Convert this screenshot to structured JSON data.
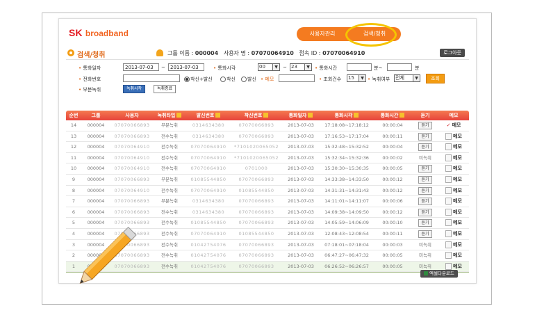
{
  "brand": {
    "sk": "SK",
    "broadband": "broadband"
  },
  "topnav": {
    "user_mgmt": "사용자관리",
    "search": "검색/청취"
  },
  "page_title": "검색/청취",
  "user_info": {
    "group_label": "그룹 이름 :",
    "group_value": "000004",
    "user_label": "사용자 명 :",
    "user_value": "07070064910",
    "login_label": "접속 ID :",
    "login_value": "07070064910"
  },
  "logout_label": "로그아웃",
  "search": {
    "date_label": "통화일자",
    "date_from": "2013-07-03",
    "date_tilde": "~",
    "date_to": "2013-07-03",
    "time_label": "통화시각",
    "time_from": "00",
    "time_tilde": "~",
    "time_to": "23",
    "duration_label": "통화시간",
    "duration_from": "",
    "duration_from_unit": "분~",
    "duration_to": "",
    "duration_to_unit": "분",
    "phone_label": "전화번호",
    "phone_value": "",
    "radio_both": "착신+발신",
    "radio_in": "착신",
    "radio_out": "발신",
    "memo_label": "메모",
    "memo_value": "",
    "count_label": "조회건수",
    "count_value": "15",
    "recyn_label": "녹취여부",
    "recyn_value": "전체",
    "search_button": "조회",
    "partial_label": "부분녹취",
    "rec_start": "녹취시작",
    "rec_end": "녹취종료"
  },
  "grid": {
    "headers": [
      "순번",
      "그룹",
      "사용자",
      "녹취타입",
      "발신번호",
      "착신번호",
      "통화일자",
      "통화시각",
      "통화시간",
      "듣기",
      "메모"
    ],
    "listen_label": "듣기",
    "none_label": "미녹취",
    "memo_label": "메모",
    "rows": [
      {
        "no": "14",
        "group": "000004",
        "user": "07070066893",
        "type": "부분녹취",
        "from": "0314634380",
        "to": "07070066893",
        "date": "2013-07-03",
        "time": "17:18:08~17:18:12",
        "dur": "00:00:04",
        "listen": "듣기",
        "memo_checked": true
      },
      {
        "no": "13",
        "group": "000004",
        "user": "07070066893",
        "type": "전수녹취",
        "from": "0314634380",
        "to": "07070066893",
        "date": "2013-07-03",
        "time": "17:16:53~17:17:04",
        "dur": "00:00:11",
        "listen": "듣기",
        "memo_checked": false
      },
      {
        "no": "12",
        "group": "000004",
        "user": "07070064910",
        "type": "전수녹취",
        "from": "07070064910",
        "to": "*7101020065052",
        "date": "2013-07-03",
        "time": "15:32:48~15:32:52",
        "dur": "00:00:04",
        "listen": "듣기",
        "memo_checked": false
      },
      {
        "no": "11",
        "group": "000004",
        "user": "07070064910",
        "type": "전수녹취",
        "from": "07070064910",
        "to": "*7101020065052",
        "date": "2013-07-03",
        "time": "15:32:34~15:32:36",
        "dur": "00:00:02",
        "listen": "미녹취",
        "memo_checked": false
      },
      {
        "no": "10",
        "group": "000004",
        "user": "07070064910",
        "type": "전수녹취",
        "from": "07070064910",
        "to": "0701000",
        "date": "2013-07-03",
        "time": "15:30:30~15:30:35",
        "dur": "00:00:05",
        "listen": "듣기",
        "memo_checked": false
      },
      {
        "no": "9",
        "group": "000004",
        "user": "07070066893",
        "type": "부분녹취",
        "from": "01085544850",
        "to": "07070066893",
        "date": "2013-07-03",
        "time": "14:33:38~14:33:50",
        "dur": "00:00:12",
        "listen": "듣기",
        "memo_checked": false
      },
      {
        "no": "8",
        "group": "000004",
        "user": "07070064910",
        "type": "전수녹취",
        "from": "07070064910",
        "to": "01085544850",
        "date": "2013-07-03",
        "time": "14:31:31~14:31:43",
        "dur": "00:00:12",
        "listen": "듣기",
        "memo_checked": false
      },
      {
        "no": "7",
        "group": "000004",
        "user": "07070066893",
        "type": "부분녹취",
        "from": "0314634380",
        "to": "07070066893",
        "date": "2013-07-03",
        "time": "14:11:01~14:11:07",
        "dur": "00:00:06",
        "listen": "듣기",
        "memo_checked": false
      },
      {
        "no": "6",
        "group": "000004",
        "user": "07070066893",
        "type": "전수녹취",
        "from": "0314634380",
        "to": "07070066893",
        "date": "2013-07-03",
        "time": "14:09:38~14:09:50",
        "dur": "00:00:12",
        "listen": "듣기",
        "memo_checked": false
      },
      {
        "no": "5",
        "group": "000004",
        "user": "07070066893",
        "type": "전수녹취",
        "from": "01085544850",
        "to": "07070066893",
        "date": "2013-07-03",
        "time": "14:05:59~14:06:09",
        "dur": "00:00:10",
        "listen": "듣기",
        "memo_checked": false
      },
      {
        "no": "4",
        "group": "000004",
        "user": "07070066893",
        "type": "전수녹취",
        "from": "07070064910",
        "to": "01085544850",
        "date": "2013-07-03",
        "time": "12:08:43~12:08:54",
        "dur": "00:00:11",
        "listen": "듣기",
        "memo_checked": false
      },
      {
        "no": "3",
        "group": "000004",
        "user": "07070066893",
        "type": "전수녹취",
        "from": "01042754076",
        "to": "07070066893",
        "date": "2013-07-03",
        "time": "07:18:01~07:18:04",
        "dur": "00:00:03",
        "listen": "미녹취",
        "memo_checked": false
      },
      {
        "no": "2",
        "group": "000004",
        "user": "07070066893",
        "type": "전수녹취",
        "from": "01042754076",
        "to": "07070066893",
        "date": "2013-07-03",
        "time": "06:47:27~06:47:32",
        "dur": "00:00:05",
        "listen": "미녹취",
        "memo_checked": false
      },
      {
        "no": "1",
        "group": "000004",
        "user": "07070066893",
        "type": "전수녹취",
        "from": "01042754076",
        "to": "07070066893",
        "date": "2013-07-03",
        "time": "06:26:52~06:26:57",
        "dur": "00:00:05",
        "listen": "미녹취",
        "memo_checked": false
      }
    ]
  },
  "excel_download": "엑셀다운로드",
  "colors": {
    "accent": "#f47b20",
    "brand_red": "#e31b23",
    "header_red": "#e7433b",
    "highlight_circle": "#f5c400"
  },
  "icons": {
    "title": "target-icon",
    "user": "user-icon",
    "sort": "sort-arrow-icon",
    "memo": "memo-icon",
    "pencil": "pencil-icon",
    "excel": "excel-icon"
  }
}
